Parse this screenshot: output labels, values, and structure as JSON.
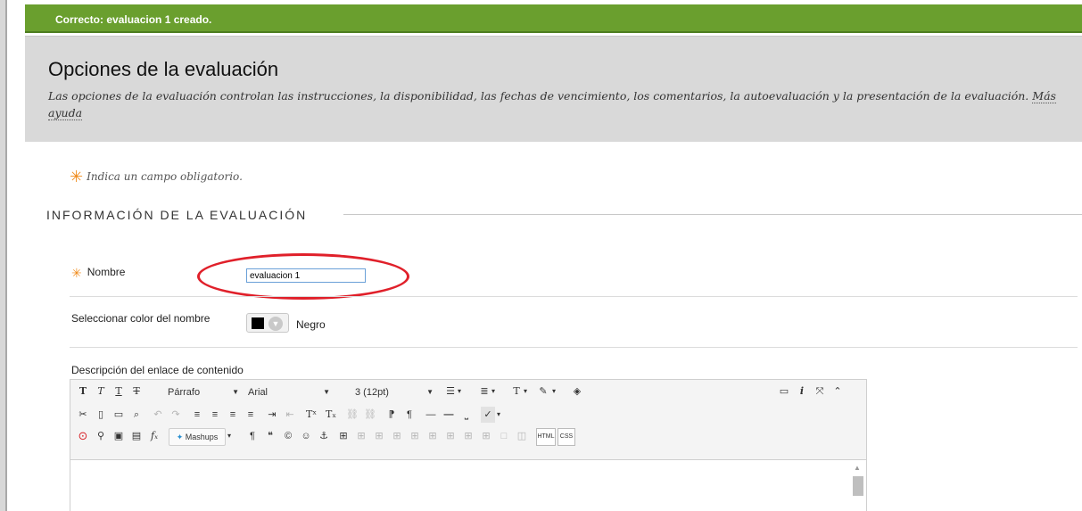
{
  "notification": {
    "text": "Correcto: evaluacion 1 creado."
  },
  "header": {
    "title": "Opciones de la evaluación",
    "description": "Las opciones de la evaluación controlan las instrucciones, la disponibilidad, las fechas de vencimiento, los comentarios, la autoevaluación y la presentación de la evaluación.",
    "help_link": "Más ayuda"
  },
  "required_note": "Indica un campo obligatorio.",
  "section": {
    "title": "INFORMACIÓN DE LA EVALUACIÓN"
  },
  "fields": {
    "name": {
      "label": "Nombre",
      "value": "evaluacion 1"
    },
    "name_color": {
      "label": "Seleccionar color del nombre",
      "value": "Negro",
      "swatch_color": "#000000"
    },
    "description": {
      "label": "Descripción del enlace de contenido"
    }
  },
  "editor": {
    "paragraph": "Párrafo",
    "font": "Arial",
    "size": "3 (12pt)",
    "mashups": "Mashups",
    "html": "HTML",
    "css": "CSS"
  },
  "colors": {
    "success_bar": "#6a9f2e",
    "required_star": "#f08c1d",
    "highlight_ellipse": "#e0202a"
  }
}
